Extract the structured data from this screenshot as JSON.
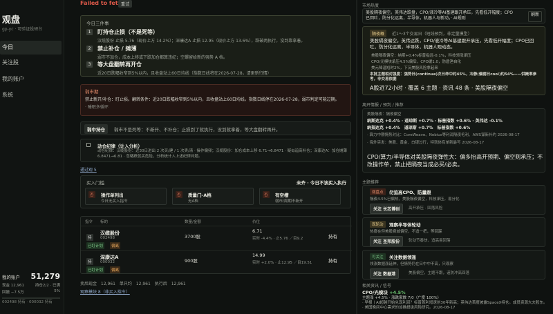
{
  "sidebar": {
    "brand": "观盘",
    "subtitle": "gp-yc · 可验证投研台",
    "items": [
      {
        "label": "今日"
      },
      {
        "label": "关注股"
      },
      {
        "label": "我的账户"
      },
      {
        "label": "系统"
      }
    ],
    "account": {
      "title": "我的账户",
      "value": "51,279",
      "cash": "现金 12,961",
      "holdings": "持仓2/2 · 已满",
      "drawdown": "回撤 −7.5万",
      "pct": "5%",
      "footer": "002498 持有 · 000032 持有"
    }
  },
  "main": {
    "fetch_status": "Failed to fetch",
    "reset_label": "重试",
    "top3": {
      "title": "今日三件事",
      "items": [
        {
          "n": "1",
          "title": "盯持仓止损（不是死等）",
          "desc": "汉缆股份 止损 5.76（现价上方 14.2%）；深康达A 止损 12.95（现价上方 13.6%），跌破两执行，没到靠拿着。"
        },
        {
          "n": "2",
          "title": "禁止补仓 / 摊薄",
          "desc": "弱市不加仓，成本上移或下跌加仓都算违纪；空螺留给新的强势 A 档。"
        },
        {
          "n": "3",
          "title": "等大盘翻转再开仓",
          "desc": "近20日跌幅收窄到5%以内，且收盘站上60日均线（指数日线将在2026-07-28，请更新行情）"
        }
      ]
    },
    "warning": {
      "title": "弱市期",
      "body": "禁止新开/补仓：盯止损。翻转条件：近20日跌幅收窄到5%以内，且收盘站上60日均线。指数日线停在2026-07-28，弱市判定可能过期。",
      "footer": "· 睡眠多循环"
    },
    "hold": {
      "chip": "弱中持仓",
      "text": "弱市不是死等：不新开、不补仓；止损到了就执行，没到就拿着，等大盘翻转再开。"
    },
    "discipline": {
      "title": "动仓纪律（计入分析）",
      "desc": "动仓纪律：汉缆股份：近30日进出 2 次买/建 / 1 次卖/清 · 操作偏频；汉缆股份：加仓成本上移 6.71→6.8471 · 疑似追高补仓；深康达A：加仓摊薄 6.8471→6.81 · 忽略跌就买危险，分析统计入上述纪律问题。"
    },
    "tracked_link": "通过观 5",
    "buy": {
      "title": "买入门槛",
      "right": "未齐 · 今日不该买入执行",
      "items": [
        {
          "tag": "否",
          "name": "操作单列出",
          "sub": "今日无买入指令"
        },
        {
          "tag": "否",
          "name": "质量门-A档",
          "sub": "无A档"
        },
        {
          "tag": "否",
          "name": "有空槽",
          "sub": "弱市/周期不新开"
        }
      ]
    },
    "table": {
      "headers": [
        "指令",
        "标的",
        "数量/金额",
        "价位"
      ],
      "rows": [
        {
          "cmd": "持",
          "name": "汉缆股份",
          "code": "002498",
          "tag1": "已盯计划",
          "tag2": "偏离",
          "qty": "3700股",
          "price": "6.71",
          "price_sub": "实时 -4.4% · 止5.76 ／目9.2",
          "action": "持有"
        },
        {
          "cmd": "持",
          "name": "深康达A",
          "code": "000032",
          "tag1": "已盯计划",
          "tag2": "偏离",
          "qty": "900股",
          "price": "14.99",
          "price_sub": "实时 +2.0% · 止12.95 ／目19.51",
          "action": "持有"
        }
      ]
    },
    "summary": "卖后现金 12,961　单只约 12,961　执行后 12,961",
    "view_link": "观察模块 8（非买入指令）"
  },
  "right": {
    "market_title": "市场热度",
    "market_text": "美股隔夜偏空。英伟达跌盘，CPO/液冷等AI基建跟开承压，先看低开幅度；CPO已回吐，防分化远离，半导体，机器人与新动，· AI规则",
    "refresh_label": "刷新",
    "eh": {
      "chip": "隔夜概",
      "title": "近1～3个交易日（短线预判，非定量模型）",
      "body": "美股隔夜偏空。英伟达跌，CPO/液冷等AI基建跟开承压，先看低开幅度；CPO已回吐，防分化远离，半导体，机器人观动态。",
      "items": [
        "美股隔夜偏空：纳斯+0.4%标普指远-0.1%，科技领涨承压",
        "CPO/光模块承压4.5%偏后，CPO缓1.0，防盾渔自化",
        "美元降温短时2%，下沉美股风险拿起来"
      ],
      "note": "本批主题相对强度：强势日(continue)次日命中约45%，冷静(偏弱日cool)约54%——供概率参考，非交易依据",
      "big": "A股近72小时 · 覆盖 6 主题 · 资讯 48 条 · 美股隔夜偏空"
    },
    "pt_title": "离开情报 / 预判 / 推荐",
    "pt": {
      "small1": "美股隔夜：隔夜偏空",
      "line1": "纳斯达克 +0.4% · 道琼斯 +0.7% · 标普指数 +0.6% · 英伟达 -0.1%",
      "line2": "纳指达克 +0.4%　道琼斯 +0.7%　标普指数 +0.6%",
      "item1": "· 算力中期情势对比：CoreWeave、Nebius等利润隔夜毛利、AWS谋新补约 2026-08-17",
      "item2": "· 海外突发：美股、黄金、白银过行，特就体有单新最写 2026-08-17",
      "big": "CPO/算力/半导体对美股隔夜弹性大：偏多抬高开预期、偏空则承压；不改操作单，禁止把隔夜当成必买/必卖。"
    },
    "ts_title": "主题推荐",
    "topics": [
      {
        "tag": "弱盘点",
        "name": "勿追高CPO、防量跟",
        "sub": "隔夜4.5%已偏热，美股隔夜偏空，科技承压，易分化",
        "btn": "关注 长芯博创",
        "side": "高开承压 · 回落风险"
      },
      {
        "tag": "观轮动",
        "name": "观察半导体轮动",
        "sub": "热度在但美股费城偏空，不追一把，等回踩",
        "btn": "关注 圣邦股份",
        "side": "轮动节奏快，追高易回落"
      },
      {
        "tag": "可关注",
        "name": "关注数据领涨",
        "sub": "领涨数据涨延伸，但情势仍在日中中不高，只观察",
        "btn": "关注 数据港",
        "side": "美股偏空，主题不跟，谨防冲高回落"
      }
    ],
    "news_title": "相关资讯 / 信号",
    "news_head": "CPO/光模块",
    "news_change": "+4.5%",
    "news_sub": "主题涨 +4.5% · 涨跌家数 7/0（广度 100%）",
    "news_line": "· 早报丨AI超越开始兑现利润？标普首利增速创30年新高；英伟达首度披露SpaceX持仓。成员资源大夫股东。· 美国晚间中心需求的加推超级风险研究。2026-08-17"
  },
  "colors": {
    "accent_green": "#6cc26f",
    "danger": "#e05a4a",
    "warning_bg": "#221512"
  }
}
